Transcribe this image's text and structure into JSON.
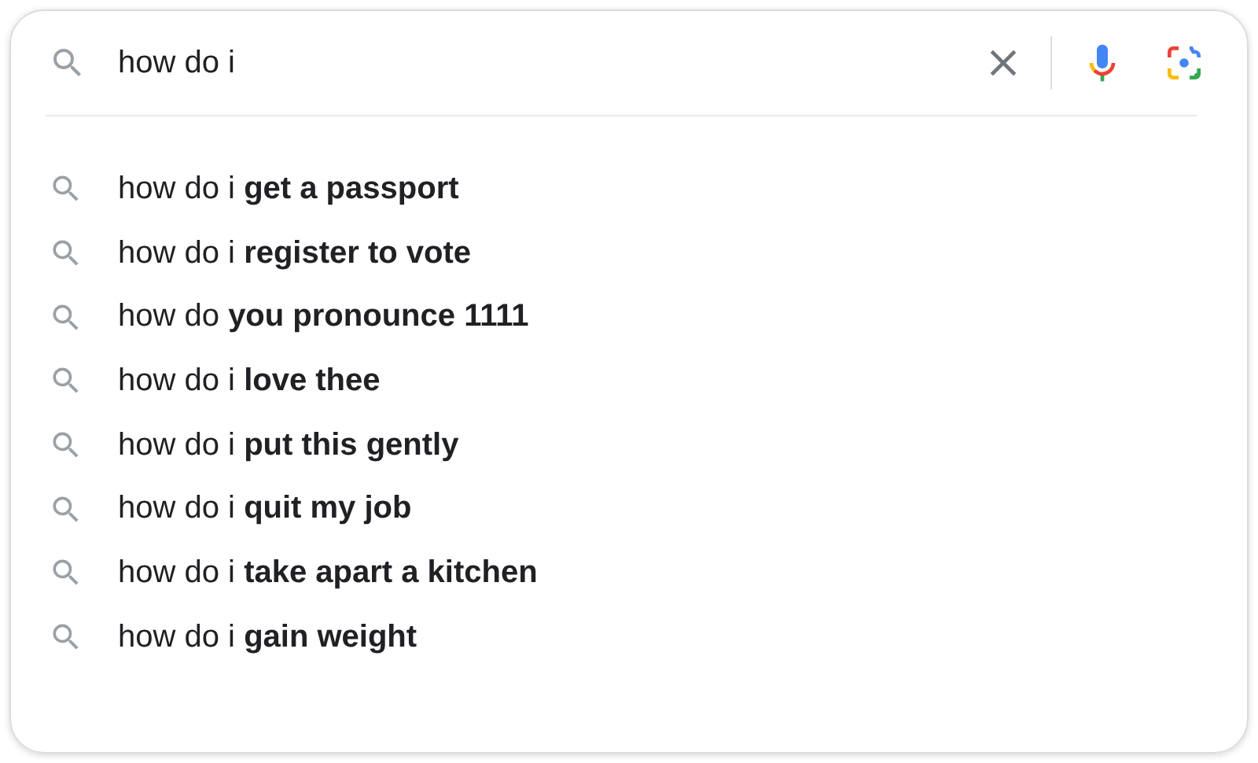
{
  "search": {
    "value": "how do i"
  },
  "suggestions": [
    {
      "text": "how do i **get a passport**"
    },
    {
      "text": "how do i **register to vote**"
    },
    {
      "text": "how do **you pronounce 1111**"
    },
    {
      "text": "how do i **love thee**"
    },
    {
      "text": "how do i **put this gently**"
    },
    {
      "text": "how do i **quit my job**"
    },
    {
      "text": "how do i **take apart a kitchen**"
    },
    {
      "text": "how do i **gain weight**"
    }
  ]
}
